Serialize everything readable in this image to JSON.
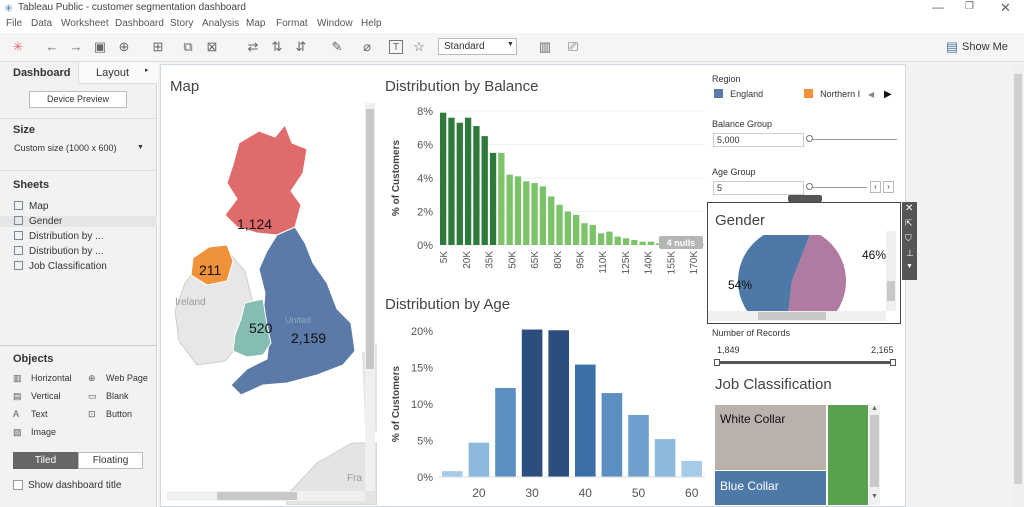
{
  "window": {
    "title": "Tableau Public - customer segmentation dashboard"
  },
  "menu": [
    "File",
    "Data",
    "Worksheet",
    "Dashboard",
    "Story",
    "Analysis",
    "Map",
    "Format",
    "Window",
    "Help"
  ],
  "toolbar": {
    "fit": "Standard",
    "show_me": "Show Me"
  },
  "left": {
    "tab_dashboard": "Dashboard",
    "tab_layout": "Layout",
    "device_preview": "Device Preview",
    "size_title": "Size",
    "size_value": "Custom size (1000 x 600)",
    "sheets_title": "Sheets",
    "sheets": [
      "Map",
      "Gender",
      "Distribution by ...",
      "Distribution by ...",
      "Job Classification"
    ],
    "objects_title": "Objects",
    "objects": {
      "horizontal": "Horizontal",
      "web_page": "Web Page",
      "vertical": "Vertical",
      "blank": "Blank",
      "text": "Text",
      "button": "Button",
      "image": "Image"
    },
    "tiled": "Tiled",
    "floating": "Floating",
    "show_title": "Show dashboard title"
  },
  "map": {
    "title": "Map",
    "labels": {
      "scotland": "1,124",
      "ni": "211",
      "wales": "520",
      "england": "2,159",
      "ireland": "Ireland",
      "united": "United",
      "france": "Fra"
    },
    "colors": {
      "scotland": "#e06b6b",
      "ni": "#f0923a",
      "wales": "#86bdb2",
      "england": "#5b7aa8"
    }
  },
  "balance": {
    "title": "Distribution by Balance",
    "nulls": "4 nulls"
  },
  "age": {
    "title": "Distribution by Age"
  },
  "chart_data": [
    {
      "type": "bar",
      "title": "Distribution by Balance",
      "ylabel": "% of Customers",
      "ylim": [
        0,
        8
      ],
      "yticks": [
        "8%",
        "6%",
        "4%",
        "2%",
        "0%"
      ],
      "xticks": [
        "5K",
        "20K",
        "35K",
        "50K",
        "65K",
        "80K",
        "95K",
        "110K",
        "125K",
        "140K",
        "155K",
        "170K"
      ],
      "values": [
        7.9,
        7.6,
        7.3,
        7.6,
        7.1,
        6.5,
        5.5,
        5.5,
        4.2,
        4.1,
        3.8,
        3.7,
        3.5,
        2.9,
        2.4,
        2.0,
        1.8,
        1.3,
        1.2,
        0.7,
        0.8,
        0.5,
        0.4,
        0.3,
        0.2,
        0.2,
        0.1,
        0.1,
        0.1,
        0.1,
        0.05,
        0.05
      ],
      "highlight_count": 7,
      "colors": [
        "#2d7a3a",
        "#7cc46a"
      ]
    },
    {
      "type": "bar",
      "title": "Distribution by Age",
      "ylabel": "% of Customers",
      "ylim": [
        0,
        20
      ],
      "yticks": [
        "20%",
        "15%",
        "10%",
        "5%",
        "0%"
      ],
      "xticks": [
        "20",
        "30",
        "40",
        "50",
        "60"
      ],
      "ages": [
        15,
        20,
        25,
        30,
        35,
        40,
        45,
        50,
        55,
        60
      ],
      "values": [
        0.8,
        4.7,
        12.2,
        20.2,
        20.1,
        15.4,
        11.5,
        8.5,
        5.2,
        2.2
      ],
      "colors": [
        "#a6cbe8",
        "#8db9df",
        "#5b8fc1",
        "#2b4e7e",
        "#2b4e7e",
        "#3d6ea5",
        "#5b8fc1",
        "#6f9fcc",
        "#8db9df",
        "#a6cbe8"
      ]
    },
    {
      "type": "pie",
      "title": "Gender",
      "slices": [
        {
          "label": "54%",
          "value": 54,
          "color": "#4e79a7"
        },
        {
          "label": "46%",
          "value": 46,
          "color": "#b07aa1"
        }
      ]
    }
  ],
  "filters": {
    "region_title": "Region",
    "region_items": [
      {
        "label": "England",
        "color": "#5b7aa8"
      },
      {
        "label": "Northern I",
        "color": "#f0923a"
      }
    ],
    "balance_group": "Balance Group",
    "balance_value": "5,000",
    "age_group": "Age Group",
    "age_value": "5",
    "records_title": "Number of Records",
    "records_min": "1,849",
    "records_max": "2,165"
  },
  "job": {
    "title": "Job Classification",
    "white": "White Collar",
    "blue": "Blue Collar"
  }
}
